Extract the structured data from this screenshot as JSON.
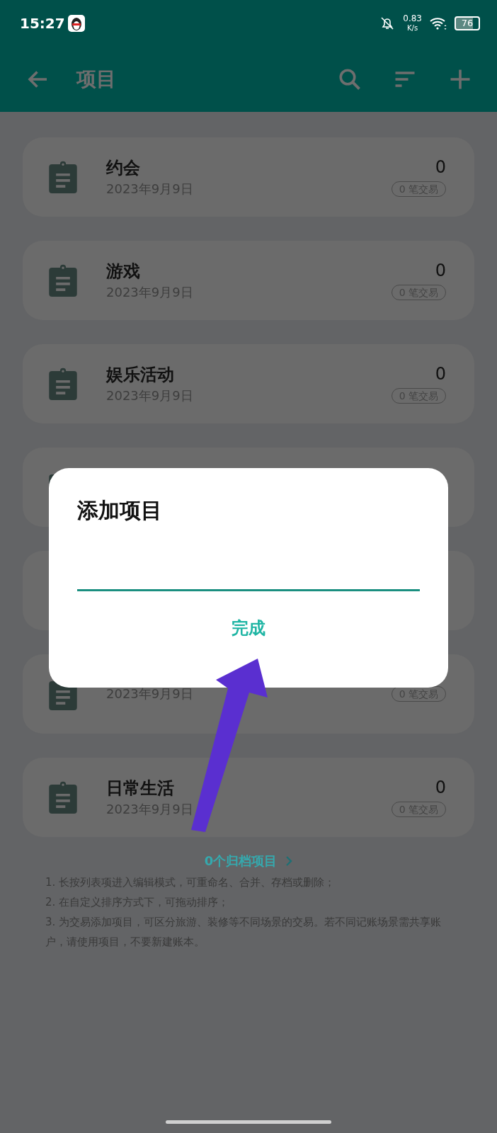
{
  "status_bar": {
    "time": "15:27",
    "net_speed": "0.83",
    "net_unit": "K/s",
    "battery": "76"
  },
  "toolbar": {
    "title": "项目"
  },
  "projects": [
    {
      "kind": "visible",
      "name": "约会",
      "date": "2023年9月9日",
      "amount": "0",
      "badge": "0 笔交易"
    },
    {
      "kind": "visible",
      "name": "游戏",
      "date": "2023年9月9日",
      "amount": "0",
      "badge": "0 笔交易"
    },
    {
      "kind": "visible",
      "name": "娱乐活动",
      "date": "2023年9月9日",
      "amount": "0",
      "badge": "0 笔交易"
    },
    {
      "kind": "covered"
    },
    {
      "kind": "hidden"
    },
    {
      "kind": "visible",
      "date": "2023年9月9日",
      "badge": "0 笔交易"
    },
    {
      "kind": "visible",
      "name": "日常生活",
      "date": "2023年9月9日",
      "amount": "0",
      "badge": "0 笔交易"
    }
  ],
  "archived_link": "0个归档项目",
  "tips": [
    "1. 长按列表项进入编辑模式，可重命名、合并、存档或删除；",
    "2. 在自定义排序方式下，可拖动排序；",
    "3. 为交易添加项目，可区分旅游、装修等不同场景的交易。若不同记账场景需共享账户，请使用项目，不要新建账本。"
  ],
  "dialog": {
    "title": "添加项目",
    "button": "完成"
  }
}
